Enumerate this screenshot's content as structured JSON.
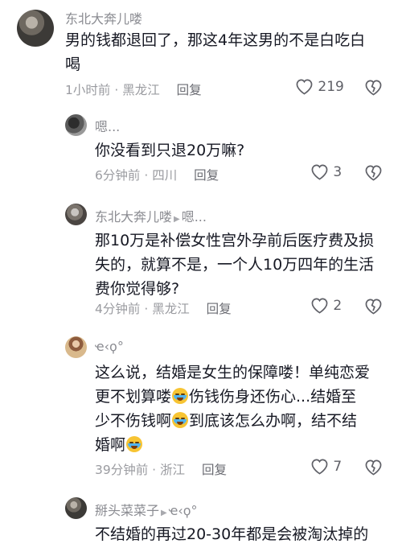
{
  "comments": [
    {
      "username": "东北大奔儿喽",
      "text_lines": [
        "男的钱都退回了，那这4年这男的不是白吃白",
        "喝"
      ],
      "time": "1小时前",
      "location": "黑龙江",
      "reply_label": "回复",
      "likes": "219"
    },
    {
      "username": "嗯...",
      "text_lines": [
        "你没看到只退20万嘛?"
      ],
      "time": "6分钟前",
      "location": "四川",
      "reply_label": "回复",
      "likes": "3"
    },
    {
      "username": "东北大奔儿喽",
      "reply_to": "嗯...",
      "text_lines": [
        "那10万是补偿女性宫外孕前后医疗费及损",
        "失的，就算不是，一个人10万四年的生活",
        "费你觉得够?"
      ],
      "time": "4分钟前",
      "location": "黑龙江",
      "reply_label": "回复",
      "likes": "2"
    },
    {
      "username": "ҽ‹ϙ°",
      "text_lines": [
        [
          "这么说，结婚是女生的保障喽！单纯恋爱"
        ],
        [
          "更不划算喽",
          "",
          "伤钱伤身还伤心...结婚至"
        ],
        [
          "少不伤钱啊",
          "",
          "到底该怎么办啊，结不结"
        ],
        [
          "婚啊",
          ""
        ]
      ],
      "time": "39分钟前",
      "location": "浙江",
      "reply_label": "回复",
      "likes": "7",
      "emoji_icon": "crying-laughing-emoji"
    },
    {
      "username": "掰头菜菜子",
      "reply_to": "ҽ‹ϙ°",
      "text_lines": [
        "不结婚的再过20-30年都是会被淘汰掉的"
      ]
    }
  ],
  "separator": "·",
  "colors": {
    "text": "#161823",
    "meta": "#9a9ba0",
    "name": "#8a8b91",
    "emoji": "#f7c433"
  }
}
